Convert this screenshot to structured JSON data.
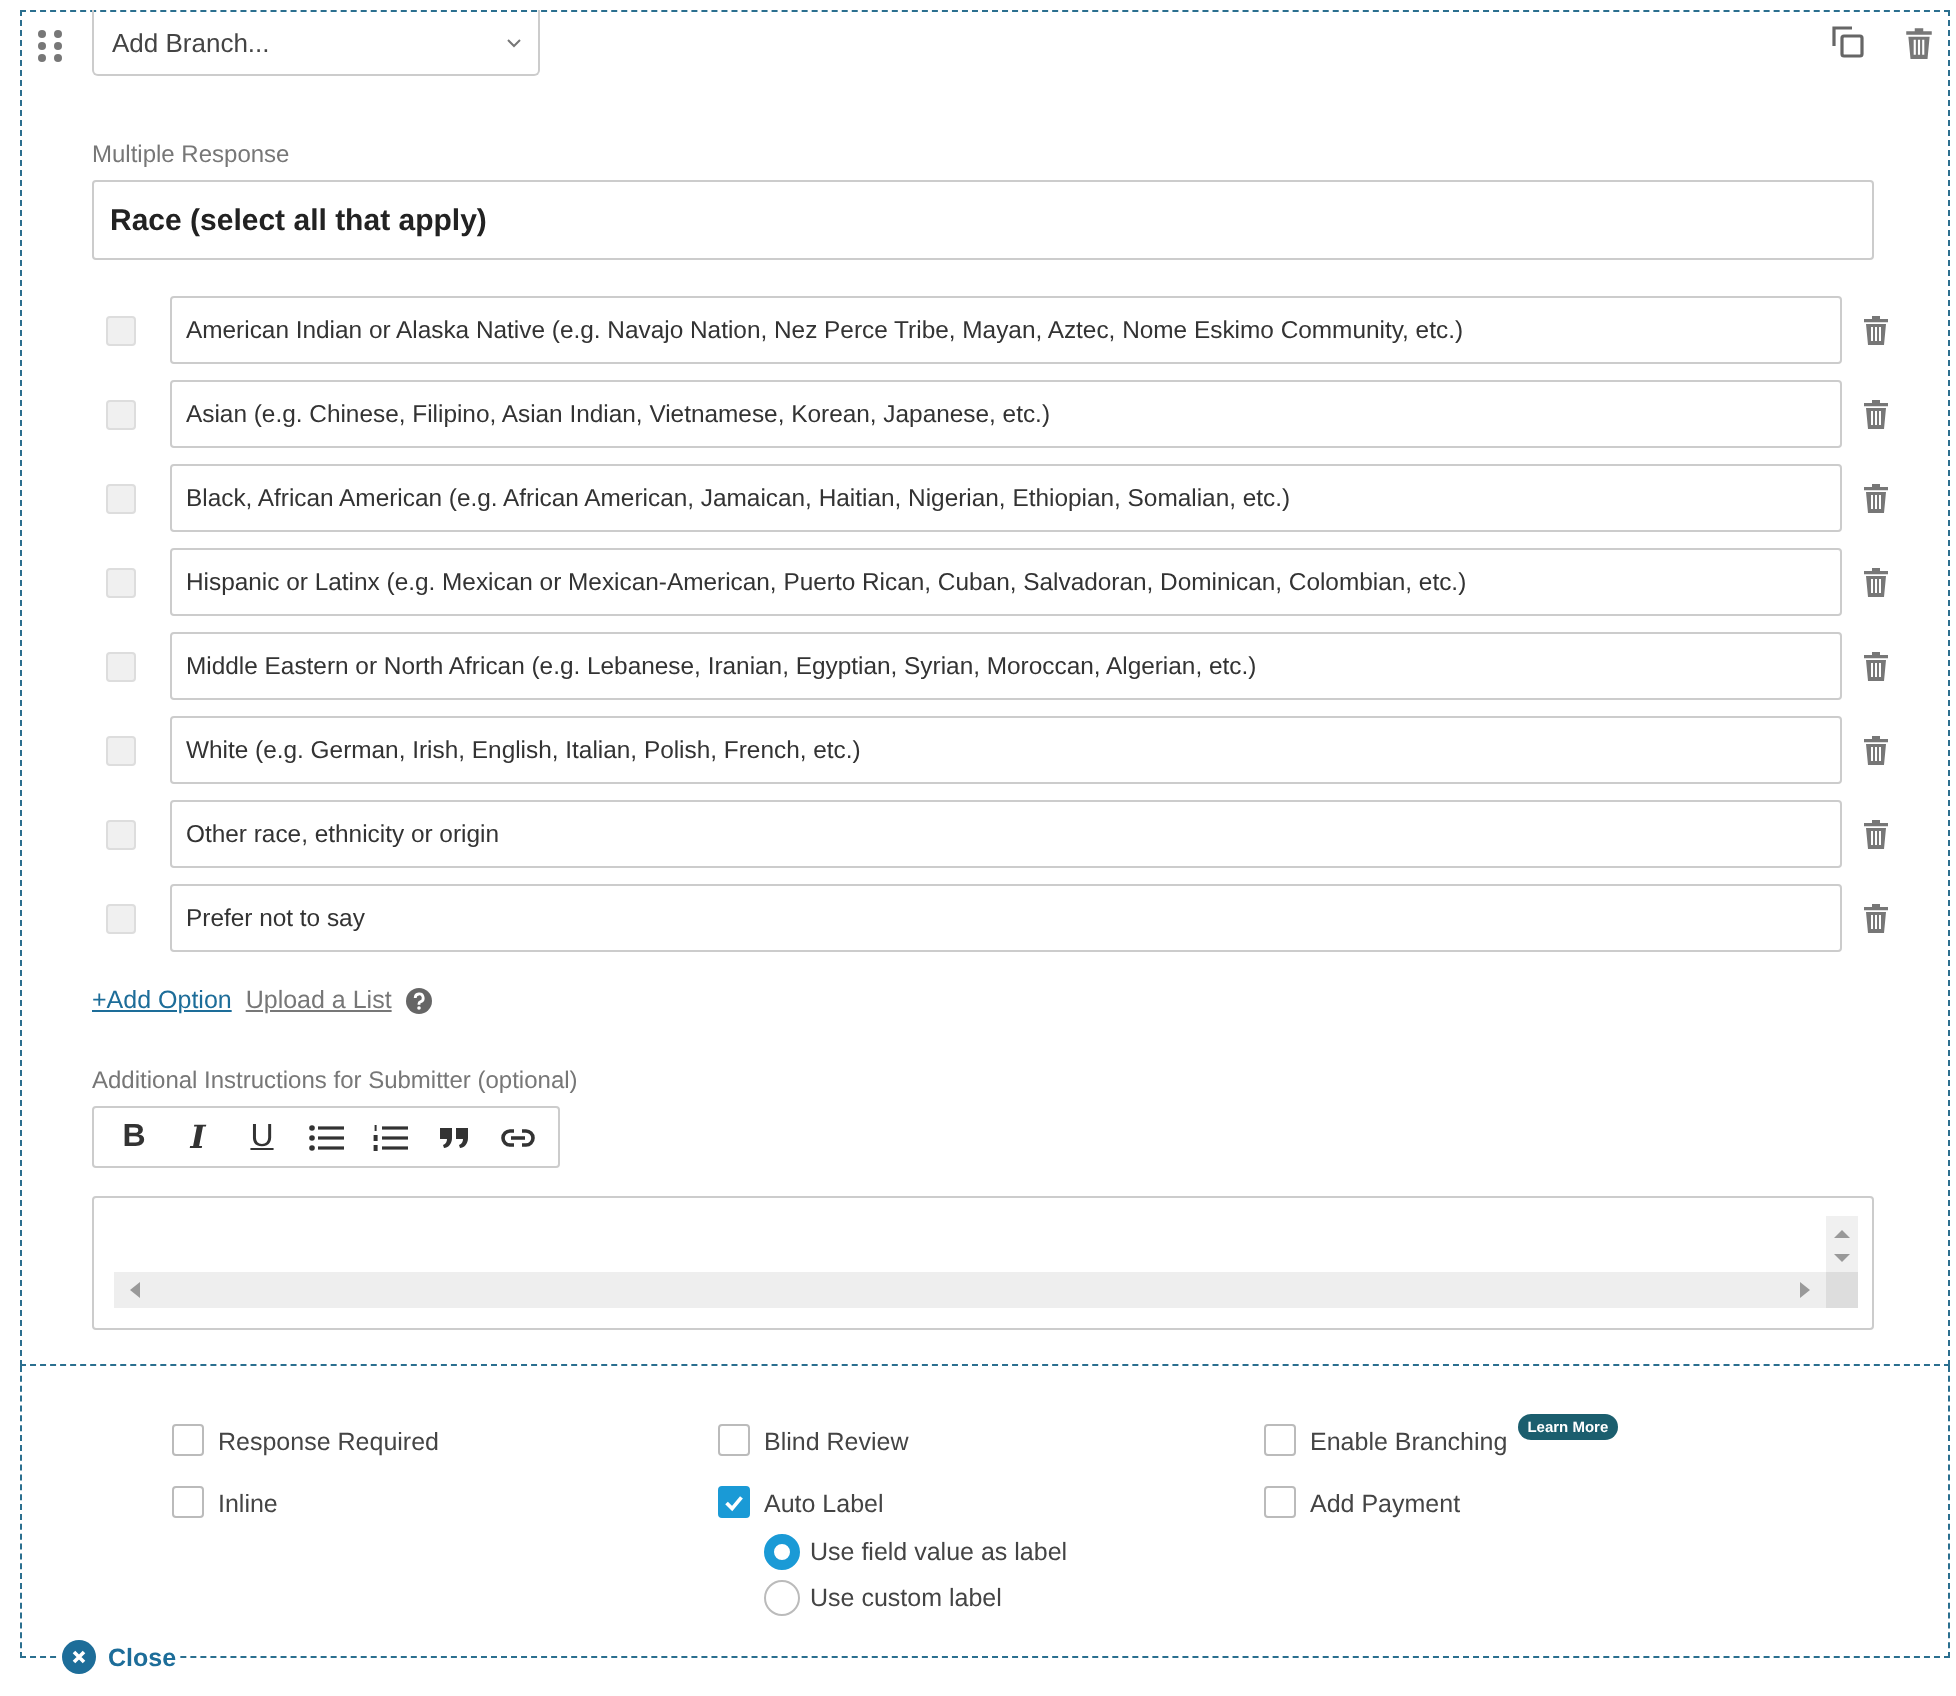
{
  "branch_select": {
    "value": "Add Branch..."
  },
  "question_type": "Multiple Response",
  "question": {
    "value": "Race (select all that apply)"
  },
  "options": [
    {
      "label": "American Indian or Alaska Native (e.g. Navajo Nation, Nez Perce Tribe, Mayan, Aztec, Nome Eskimo Community, etc.)",
      "checked": false
    },
    {
      "label": "Asian (e.g. Chinese, Filipino, Asian Indian, Vietnamese, Korean, Japanese, etc.)",
      "checked": false
    },
    {
      "label": "Black, African American (e.g. African American, Jamaican, Haitian, Nigerian, Ethiopian, Somalian, etc.)",
      "checked": false
    },
    {
      "label": "Hispanic or Latinx (e.g. Mexican or Mexican-American, Puerto Rican, Cuban, Salvadoran, Dominican, Colombian, etc.)",
      "checked": false
    },
    {
      "label": "Middle Eastern or North African (e.g. Lebanese, Iranian, Egyptian, Syrian, Moroccan, Algerian, etc.)",
      "checked": false
    },
    {
      "label": "White (e.g. German, Irish, English, Italian, Polish, French, etc.)",
      "checked": false
    },
    {
      "label": "Other race, ethnicity or origin",
      "checked": false
    },
    {
      "label": "Prefer not to say",
      "checked": false
    }
  ],
  "add_option": "+Add Option",
  "upload_list": "Upload a List",
  "instructions_label": "Additional Instructions for Submitter (optional)",
  "toolbar": [
    {
      "kind": "bold",
      "glyph": "B"
    },
    {
      "kind": "italic",
      "glyph": "I"
    },
    {
      "kind": "underline",
      "glyph": "U"
    },
    {
      "kind": "bullets"
    },
    {
      "kind": "numbers"
    },
    {
      "kind": "quote"
    },
    {
      "kind": "link"
    }
  ],
  "settings": [
    {
      "label": "Response Required",
      "checked": false
    },
    {
      "label": "Blind Review",
      "checked": false
    },
    {
      "label": "Enable Branching",
      "checked": false,
      "badge": "Learn More"
    },
    {
      "label": "Inline",
      "checked": false
    },
    {
      "label": "Auto Label",
      "checked": true,
      "choices": [
        {
          "label": "Use field value as label",
          "selected": true
        },
        {
          "label": "Use custom label",
          "selected": false
        }
      ]
    },
    {
      "label": "Add Payment",
      "checked": false
    }
  ],
  "close": "Close"
}
